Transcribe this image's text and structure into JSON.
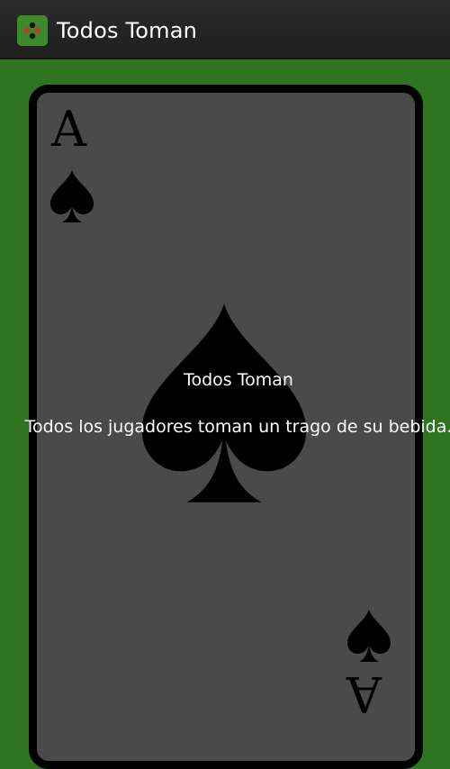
{
  "header": {
    "title": "Todos Toman"
  },
  "card": {
    "rank": "A",
    "suit": "spade-icon"
  },
  "rule": {
    "title": "Todos Toman",
    "description": "Todos los jugadores toman un trago de su bebida."
  },
  "colors": {
    "background": "#2f7420",
    "action_bar": "#222222",
    "card_face": "#4a4a4a",
    "card_border": "#000000",
    "text": "#ffffff"
  }
}
